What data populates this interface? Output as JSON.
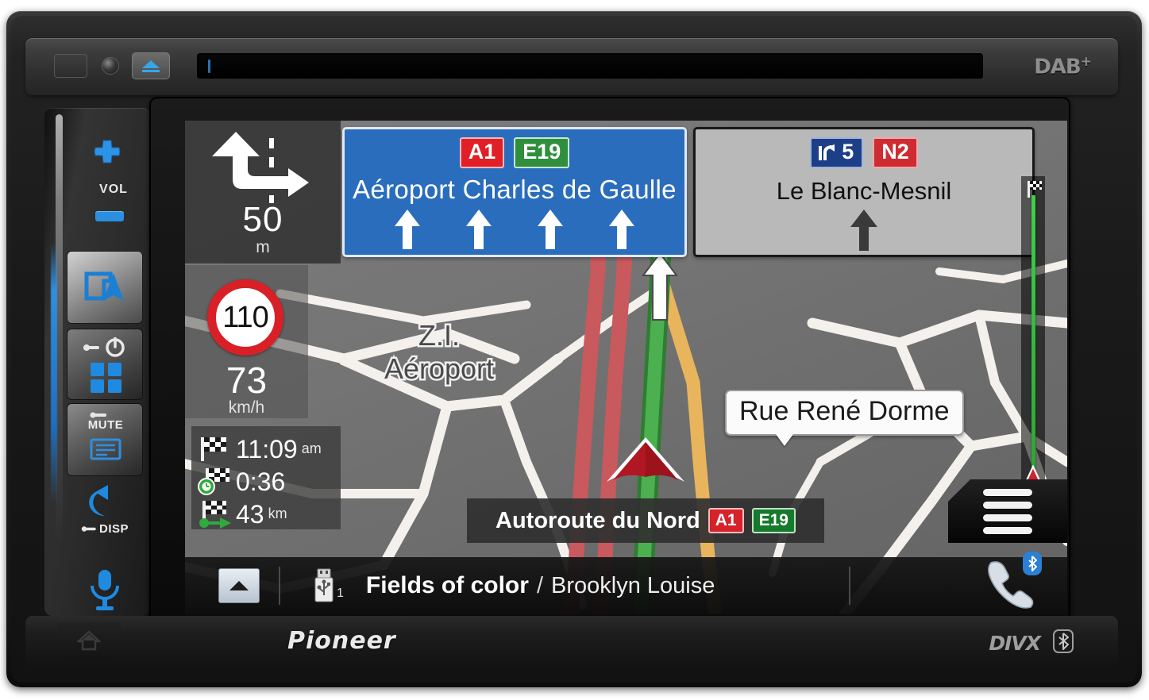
{
  "device": {
    "brand": "Pioneer",
    "top_badges": {
      "dab": "DAB",
      "dab_plus": "+"
    },
    "bottom_badges": {
      "divx": "DIVX",
      "bluetooth_icon": "bluetooth-icon"
    },
    "front_controls": {
      "reset": "reset-button",
      "sensor": "remote-sensor",
      "eject": "eject-button",
      "disc_slot": "disc-slot",
      "home": "home-button"
    }
  },
  "left_buttons": {
    "volume_label": "VOL",
    "volume_up_icon": "plus-icon",
    "volume_down_icon": "minus-icon",
    "nav_icon": "navigation-map-icon",
    "power_icon": "power-icon",
    "apps_icon": "apps-grid-icon",
    "mute_label": "MUTE",
    "mute_icon": "screen-icon",
    "disp_label": "DISP",
    "disp_icon": "back-arrow-icon",
    "voice_icon": "microphone-icon"
  },
  "navigation": {
    "maneuver": {
      "icon": "lane-merge-left-icon",
      "distance": "50",
      "distance_unit": "m"
    },
    "speed": {
      "limit": "110",
      "current": "73",
      "unit": "km/h"
    },
    "trip": [
      {
        "icon": "checkered-flag-icon",
        "value": "11:09",
        "suffix": "am"
      },
      {
        "icon": "checkered-flag-clock-icon",
        "value": "0:36",
        "suffix": ""
      },
      {
        "icon": "checkered-flag-arrow-icon",
        "value": "43",
        "suffix": "km"
      }
    ],
    "sign_primary": {
      "text": "Aéroport Charles de Gaulle",
      "shields": [
        {
          "label": "A1",
          "type": "motorway"
        },
        {
          "label": "E19",
          "type": "european"
        }
      ],
      "lane_arrow_count": 4,
      "background_color": "#2a6dbd"
    },
    "sign_secondary": {
      "text": "Le Blanc-Mesnil",
      "exit_number": "5",
      "exit_icon": "exit-right-icon",
      "shields": [
        {
          "label": "N2",
          "type": "national"
        }
      ],
      "background_color": "#b9b9b9"
    },
    "street_callout": "Rue René Dorme",
    "area_label_line1": "Z.I.",
    "area_label_line2": "Aéroport",
    "road_banner": {
      "name": "Autoroute du Nord",
      "shields": [
        {
          "label": "A1",
          "type": "motorway"
        },
        {
          "label": "E19",
          "type": "european"
        }
      ]
    },
    "route_progress": {
      "destination_icon": "checkered-flag-icon",
      "position_icon": "position-arrow-icon",
      "line_color": "#3fd04b"
    },
    "menu_button_icon": "hamburger-menu-icon",
    "vehicle_marker_icon": "vehicle-arrow-icon"
  },
  "media_bar": {
    "expand_icon": "chevron-up-icon",
    "source_icon": "usb-icon",
    "source_index": "1",
    "track_title": "Fields of color",
    "separator": "/",
    "artist": "Brooklyn Louise",
    "phone_icon": "phone-handset-icon",
    "bluetooth_icon": "bluetooth-icon"
  }
}
